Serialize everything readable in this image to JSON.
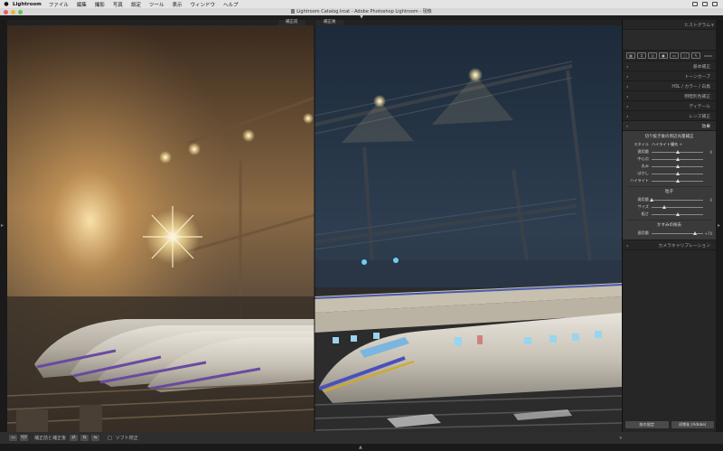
{
  "menubar": {
    "app_name": "Lightroom",
    "items": [
      "ファイル",
      "編集",
      "撮影",
      "写真",
      "設定",
      "ツール",
      "表示",
      "ウィンドウ",
      "ヘルプ"
    ]
  },
  "window": {
    "title": "Lightroom Catalog.lrcat - Adobe Photoshop Lightroom - 現像"
  },
  "view": {
    "before_label": "補正前",
    "after_label": "補正後"
  },
  "right_panel": {
    "histogram_title": "ヒストグラム",
    "sections": [
      {
        "label": "基本補正",
        "active": false
      },
      {
        "label": "トーンカーブ",
        "active": false
      },
      {
        "label": "HSL / カラー / 白黒",
        "active": false
      },
      {
        "label": "明暗別色補正",
        "active": false
      },
      {
        "label": "ディテール",
        "active": false
      },
      {
        "label": "レンズ補正",
        "active": false
      },
      {
        "label": "効果",
        "active": true
      }
    ],
    "effects": {
      "vignette_title": "切り抜き後の周辺光量補正",
      "style_label": "スタイル",
      "style_value": "ハイライト優先 ÷",
      "vignette_rows": [
        {
          "label": "適用量",
          "value": "0",
          "pos": 0.5
        },
        {
          "label": "中心点",
          "value": "",
          "pos": 0.5
        },
        {
          "label": "丸み",
          "value": "",
          "pos": 0.5
        },
        {
          "label": "ぼかし",
          "value": "",
          "pos": 0.5
        },
        {
          "label": "ハイライト",
          "value": "",
          "pos": 0.5
        }
      ],
      "grain_title": "粒子",
      "grain_rows": [
        {
          "label": "適用量",
          "value": "0",
          "pos": 0.0
        },
        {
          "label": "サイズ",
          "value": "",
          "pos": 0.25
        },
        {
          "label": "粗さ",
          "value": "",
          "pos": 0.5
        }
      ],
      "haze_title": "かすみの除去",
      "haze_rows": [
        {
          "label": "適用量",
          "value": "+70",
          "pos": 0.85
        }
      ]
    },
    "calibration_title": "カメラキャリブレーション",
    "buttons": {
      "previous": "前の設定",
      "reset": "初期化 (Adobe)"
    }
  },
  "bottom_toolbar": {
    "view_mode_label": "補正前と補正後",
    "softproof_label": "ソフト校正"
  }
}
